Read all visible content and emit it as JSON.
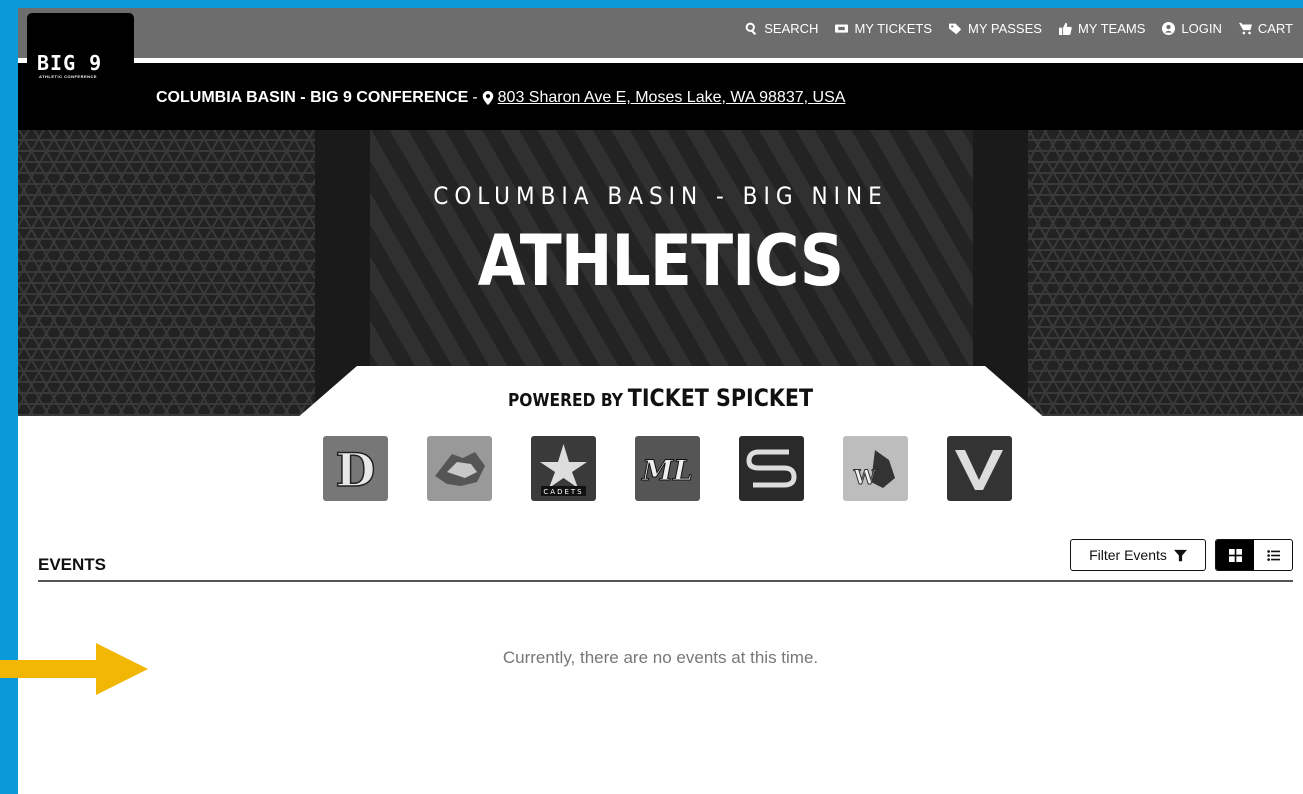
{
  "nav": {
    "items": [
      {
        "label": "SEARCH",
        "icon": "search-icon"
      },
      {
        "label": "MY TICKETS",
        "icon": "ticket-icon"
      },
      {
        "label": "MY PASSES",
        "icon": "tag-icon"
      },
      {
        "label": "MY TEAMS",
        "icon": "thumbs-up-icon"
      },
      {
        "label": "LOGIN",
        "icon": "user-circle-icon"
      },
      {
        "label": "CART",
        "icon": "cart-icon"
      }
    ]
  },
  "logo": {
    "text": "BIG 9",
    "subtext": "ATHLETIC CONFERENCE"
  },
  "conference": {
    "name": "COLUMBIA BASIN - BIG 9 CONFERENCE",
    "separator": "-",
    "address": "803 Sharon Ave E, Moses Lake, WA 98837, USA"
  },
  "hero": {
    "subtitle": "COLUMBIA BASIN - BIG NINE",
    "title": "ATHLETICS",
    "powered_by": "POWERED BY",
    "brand": "TICKET SPICKET"
  },
  "teams": [
    {
      "label": "D",
      "bg": "#777777"
    },
    {
      "label": "",
      "bg": "#999999"
    },
    {
      "label": "CADETS",
      "bg": "#3a3a3a"
    },
    {
      "label": "ML",
      "bg": "#555555"
    },
    {
      "label": "S",
      "bg": "#2a2a2a"
    },
    {
      "label": "W",
      "bg": "#bdbdbd"
    },
    {
      "label": "WV",
      "bg": "#333333"
    }
  ],
  "events": {
    "heading": "EVENTS",
    "filter_label": "Filter Events",
    "empty_message": "Currently, there are no events at this time."
  },
  "colors": {
    "accent": "#0a9ad9",
    "arrow": "#f2b705",
    "hero": "#262626"
  }
}
